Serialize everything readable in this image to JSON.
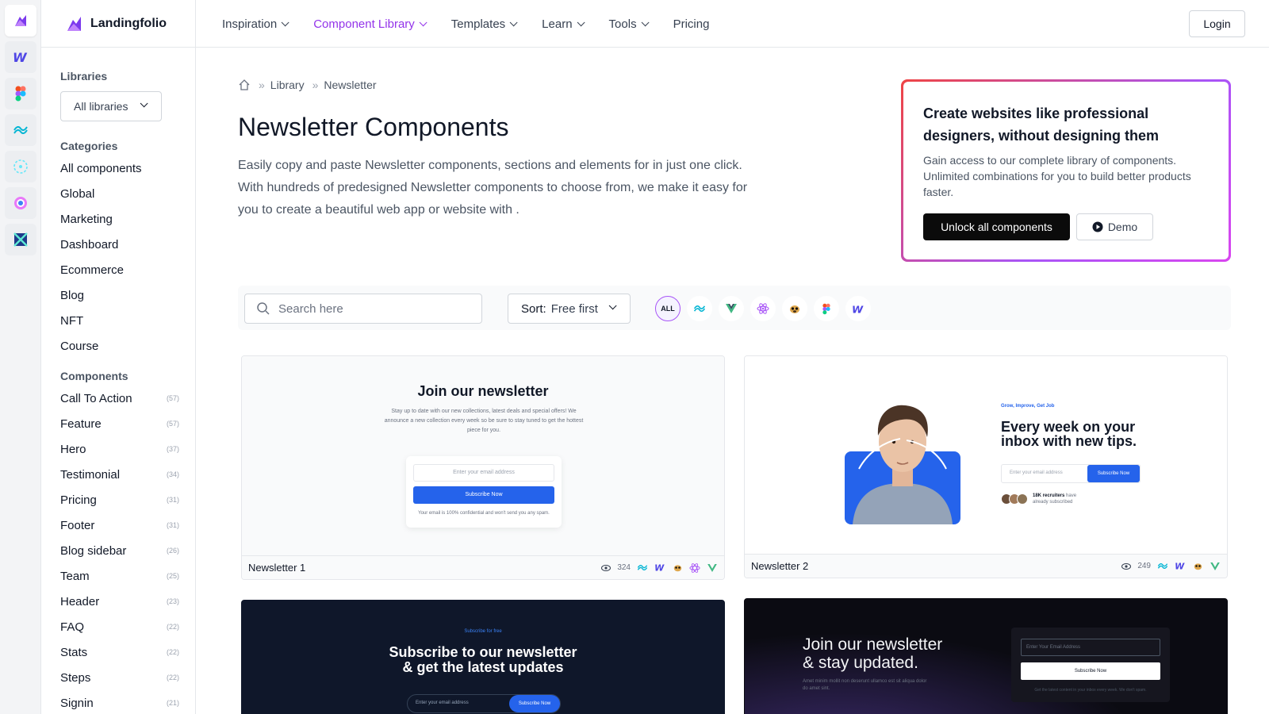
{
  "brand": {
    "name": "Landingfolio"
  },
  "nav": {
    "items": [
      {
        "label": "Inspiration",
        "dropdown": true
      },
      {
        "label": "Component Library",
        "dropdown": true,
        "active": true
      },
      {
        "label": "Templates",
        "dropdown": true
      },
      {
        "label": "Learn",
        "dropdown": true
      },
      {
        "label": "Tools",
        "dropdown": true
      },
      {
        "label": "Pricing",
        "dropdown": false
      }
    ],
    "login_label": "Login"
  },
  "rail": {
    "icons": [
      "landingfolio-icon",
      "webflow-icon",
      "figma-icon",
      "tailwind-icon",
      "react-icon",
      "chrome-icon",
      "sketch-icon"
    ]
  },
  "sidebar": {
    "libraries_heading": "Libraries",
    "libraries_select": "All libraries",
    "categories_heading": "Categories",
    "categories": [
      "All components",
      "Global",
      "Marketing",
      "Dashboard",
      "Ecommerce",
      "Blog",
      "NFT",
      "Course"
    ],
    "components_heading": "Components",
    "components": [
      {
        "label": "Call To Action",
        "count": "(57)"
      },
      {
        "label": "Feature",
        "count": "(57)"
      },
      {
        "label": "Hero",
        "count": "(37)"
      },
      {
        "label": "Testimonial",
        "count": "(34)"
      },
      {
        "label": "Pricing",
        "count": "(31)"
      },
      {
        "label": "Footer",
        "count": "(31)"
      },
      {
        "label": "Blog sidebar",
        "count": "(26)"
      },
      {
        "label": "Team",
        "count": "(25)"
      },
      {
        "label": "Header",
        "count": "(23)"
      },
      {
        "label": "FAQ",
        "count": "(22)"
      },
      {
        "label": "Stats",
        "count": "(22)"
      },
      {
        "label": "Steps",
        "count": "(22)"
      },
      {
        "label": "Signin",
        "count": "(21)"
      }
    ]
  },
  "breadcrumb": {
    "items": [
      "Library",
      "Newsletter"
    ]
  },
  "page": {
    "title": "Newsletter Components",
    "description": "Easily copy and paste Newsletter components, sections and elements for in just one click. With hundreds of predesigned Newsletter components to choose from, we make it easy for you to create a beautiful web app or website with ."
  },
  "promo": {
    "title": "Create websites like professional designers, without designing them",
    "text": "Gain access to our complete library of components. Unlimited combinations for you to build better products faster.",
    "primary_label": "Unlock all components",
    "secondary_label": "Demo"
  },
  "filters": {
    "search_placeholder": "Search here",
    "sort_label": "Sort:",
    "sort_value": "Free first",
    "all_label": "ALL",
    "library_icons": [
      "tailwind-icon",
      "vue-icon",
      "react-icon",
      "pug-icon",
      "figma-icon",
      "webflow-icon"
    ]
  },
  "cards": [
    {
      "name": "Newsletter 1",
      "views": "324",
      "preview": {
        "title": "Join our newsletter",
        "text": "Stay up to date with our new collections, latest deals and special offers! We announce a new collection every week so be sure to stay tuned to get the hottest piece for you.",
        "placeholder": "Enter your email address",
        "button": "Subscribe Now",
        "note": "Your email is 100% confidential and won't send you any spam."
      }
    },
    {
      "name": "Newsletter 2",
      "views": "249",
      "preview": {
        "eyebrow": "Grow, Improve, Get Job",
        "title": "Every week on your inbox with new tips.",
        "placeholder": "Enter your email address",
        "button": "Subscribe Now",
        "social_bold": "18K recruiters",
        "social_rest": "have already subscribed"
      }
    },
    {
      "preview": {
        "eyebrow": "Subscribe for free",
        "title_line1": "Subscribe to our newsletter",
        "title_line2": "& get the latest updates",
        "placeholder": "Enter your email address",
        "button": "Subscribe Now"
      }
    },
    {
      "preview": {
        "title_line1": "Join our newsletter",
        "title_line2": "& stay updated.",
        "text": "Amet minim mollit non deserunt ullamco est sit aliqua dolor do amet sint.",
        "placeholder": "Enter Your Email Address",
        "button": "Subscribe Now",
        "note": "Get the latest content in your inbox every week. We don't spam."
      }
    }
  ],
  "colors": {
    "accent": "#9333ea",
    "primary_blue": "#2563eb",
    "dark_card": "#0f172a"
  }
}
